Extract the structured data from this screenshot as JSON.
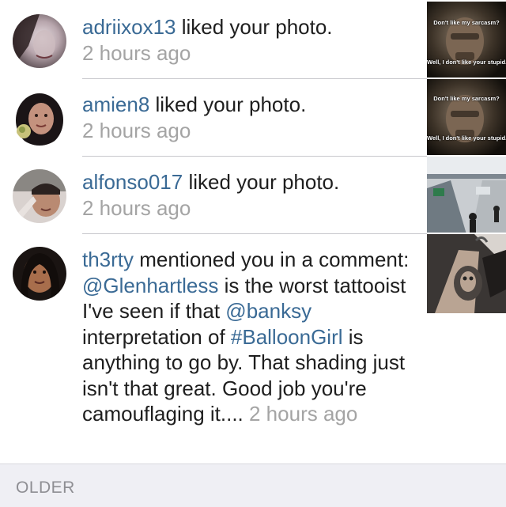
{
  "notifications": [
    {
      "username": "adriixox13",
      "action": " liked your photo.",
      "time": "2 hours ago",
      "thumb": {
        "top_caption": "Don't like my sarcasm?",
        "bottom_caption": "Well, I don't like your stupid."
      }
    },
    {
      "username": "amien8",
      "action": " liked your photo.",
      "time": "2 hours ago",
      "thumb": {
        "top_caption": "Don't like my sarcasm?",
        "bottom_caption": "Well, I don't like your stupid."
      }
    },
    {
      "username": "alfonso017",
      "action": " liked your photo.",
      "time": "2 hours ago"
    },
    {
      "username": "th3rty",
      "action": " mentioned you in a comment: ",
      "mention1": "@Glenhartless",
      "text2": " is the worst tattooist I've seen if that ",
      "mention2": "@banksy",
      "text3": " interpretation of ",
      "hashtag": "#BalloonGirl",
      "text4": " is anything to go by. That shading just isn't that great. Good job you're camouflaging it.... ",
      "time": "2 hours ago"
    }
  ],
  "footer": {
    "older_label": "OLDER"
  }
}
